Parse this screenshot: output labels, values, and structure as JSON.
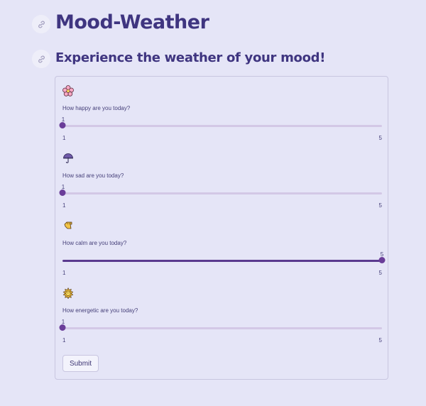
{
  "header": {
    "title": "Mood-Weather",
    "subtitle": "Experience the weather of your mood!"
  },
  "icons": {
    "anchor": "link-icon"
  },
  "sliders": [
    {
      "emoji": "cherry-blossom-icon",
      "label": "How happy are you today?",
      "value": 1,
      "min": 1,
      "max": 5
    },
    {
      "emoji": "umbrella-icon",
      "label": "How sad are you today?",
      "value": 1,
      "min": 1,
      "max": 5
    },
    {
      "emoji": "hand-icon",
      "label": "How calm are you today?",
      "value": 5,
      "min": 1,
      "max": 5
    },
    {
      "emoji": "sun-icon",
      "label": "How energetic are you today?",
      "value": 1,
      "min": 1,
      "max": 5
    }
  ],
  "form": {
    "submit_label": "Submit"
  },
  "colors": {
    "background": "#e5e5f7",
    "title": "#3f3580",
    "slider_thumb": "#6a3d99",
    "slider_track": "#d3c8e6"
  }
}
